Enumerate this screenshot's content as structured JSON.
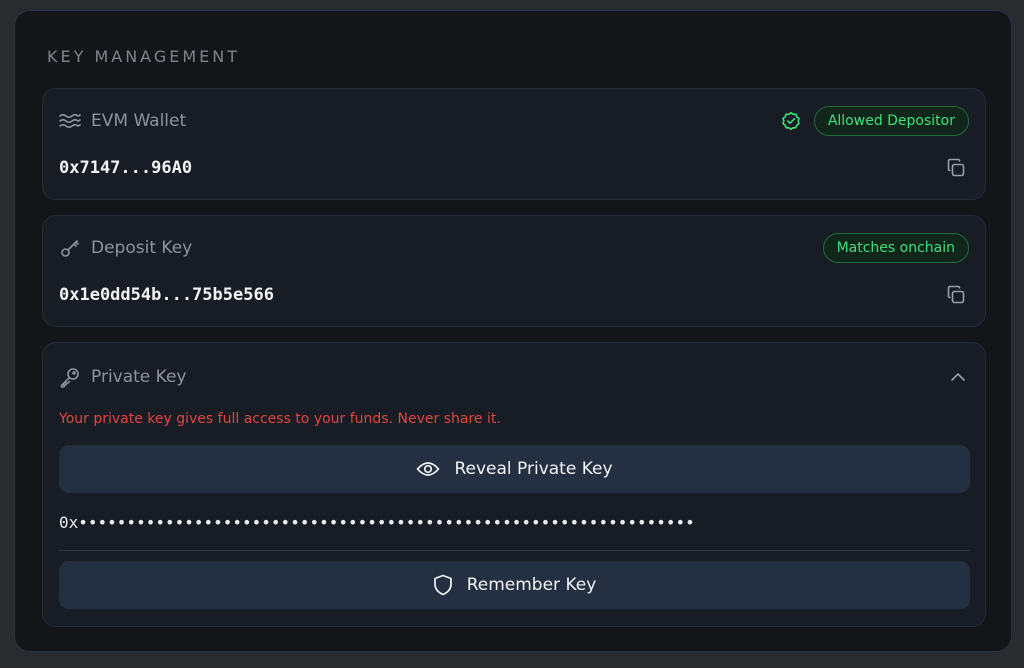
{
  "panel": {
    "title": "KEY MANAGEMENT"
  },
  "evm_wallet": {
    "label": "EVM Wallet",
    "icon": "waves-icon",
    "badge": "Allowed Depositor",
    "badge_icon": "check-badge-icon",
    "address": "0x7147...96A0",
    "copy_icon": "copy-icon"
  },
  "deposit_key": {
    "label": "Deposit Key",
    "icon": "key-icon",
    "badge": "Matches onchain",
    "value": "0x1e0dd54b...75b5e566",
    "copy_icon": "copy-icon"
  },
  "private_key": {
    "label": "Private Key",
    "icon": "key-icon",
    "chevron_icon": "chevron-up-icon",
    "warning": "Your private key gives full access to your funds. Never share it.",
    "reveal_label": "Reveal Private Key",
    "reveal_icon": "eye-icon",
    "masked_value": "0x••••••••••••••••••••••••••••••••••••••••••••••••••••••••••••••••",
    "remember_label": "Remember Key",
    "remember_icon": "shield-icon"
  },
  "colors": {
    "background": "#141518",
    "card": "#181c24",
    "button": "#243042",
    "badge_green": "#3ee07a",
    "warning_red": "#e0463f"
  }
}
